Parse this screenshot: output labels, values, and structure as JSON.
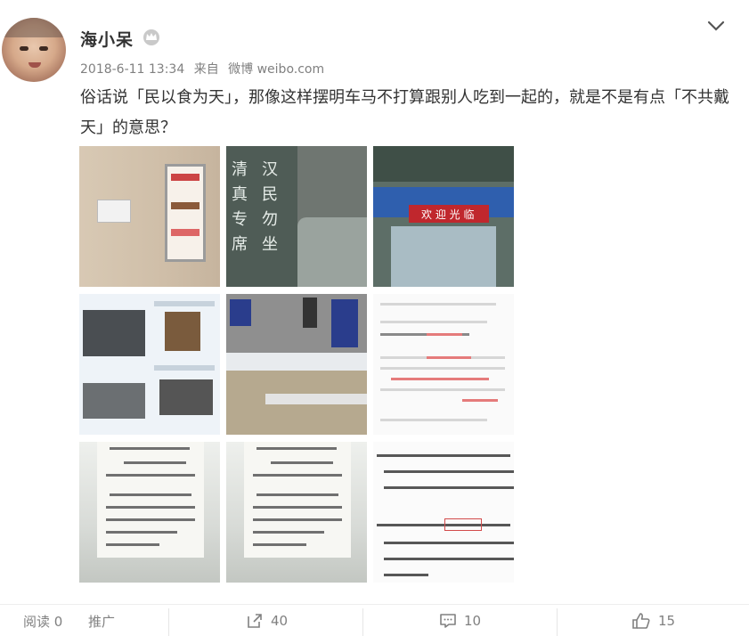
{
  "user": {
    "name": "海小呆",
    "date": "2018-6-11 13:34",
    "source_prefix": "来自",
    "source": "微博 weibo.com"
  },
  "post": {
    "text": "俗话说「民以食为天」，那像这样摆明车马不打算跟别人吃到一起的，就是不是有点「不共戴天」的意思？"
  },
  "images": [
    {
      "name": "photo-1",
      "sign_text": "禁止汉民在此进餐"
    },
    {
      "name": "photo-2",
      "sign_text": "清真专席 汉民勿坐"
    },
    {
      "name": "photo-3",
      "sign_text": "欢迎光临"
    },
    {
      "name": "photo-4"
    },
    {
      "name": "photo-5"
    },
    {
      "name": "photo-6",
      "sign_text": "关于沧州师范学院设立回民餐厅的说明"
    },
    {
      "name": "photo-7"
    },
    {
      "name": "photo-8"
    },
    {
      "name": "photo-9",
      "sign_text": "严禁在清真食堂门口设非清真食品"
    }
  ],
  "actions": {
    "read_label": "阅读 0",
    "promote_label": "推广",
    "repost_count": "40",
    "comment_count": "10",
    "like_count": "15"
  },
  "icons": {
    "badge": "crown-badge-icon",
    "collapse": "chevron-down-icon",
    "repost": "repost-icon",
    "comment": "comment-icon",
    "like": "thumbs-up-icon"
  }
}
